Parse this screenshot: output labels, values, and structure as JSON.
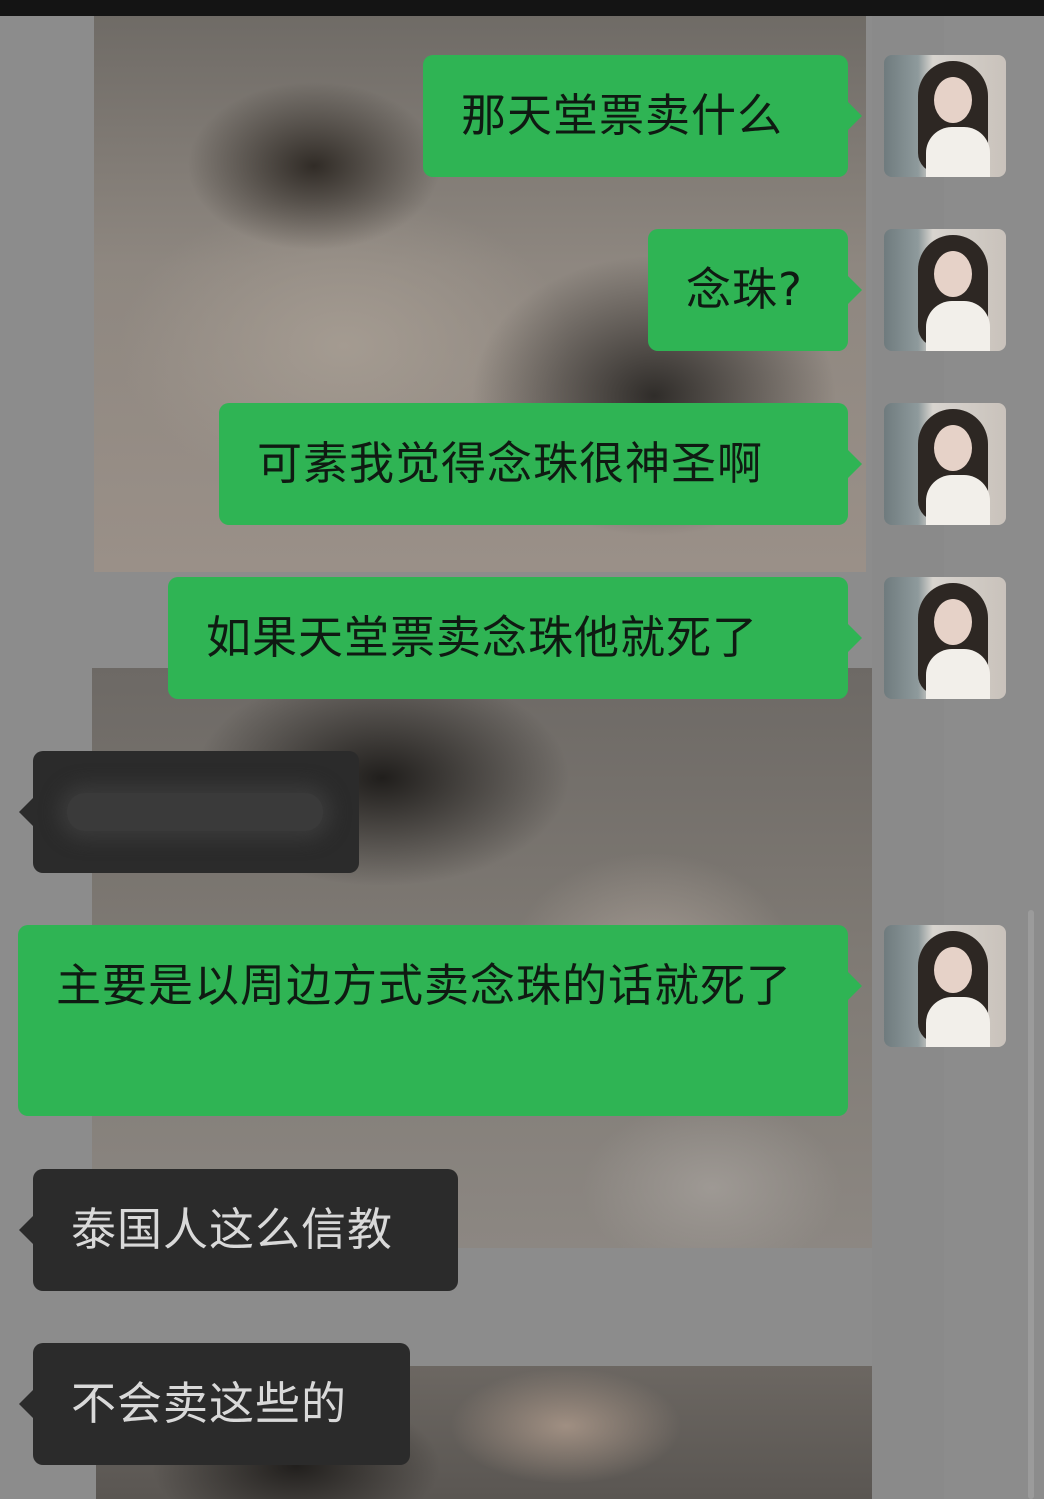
{
  "chat": {
    "messages": [
      {
        "id": "m1",
        "direction": "sent",
        "text": "那天堂票卖什么"
      },
      {
        "id": "m2",
        "direction": "sent",
        "text": "念珠?"
      },
      {
        "id": "m3",
        "direction": "sent",
        "text": "可素我觉得念珠很神圣啊"
      },
      {
        "id": "m4",
        "direction": "sent",
        "text": "如果天堂票卖念珠他就死了"
      },
      {
        "id": "m5",
        "direction": "received",
        "text": "",
        "redacted": true
      },
      {
        "id": "m6",
        "direction": "sent",
        "text": "主要是以周边方式卖念珠的话就死了"
      },
      {
        "id": "m7",
        "direction": "received",
        "text": "泰国人这么信教"
      },
      {
        "id": "m8",
        "direction": "received",
        "text": "不会卖这些的"
      }
    ]
  },
  "colors": {
    "sent_bubble": "#2fb454",
    "received_bubble": "#2b2b2b",
    "background": "#8c8c8c"
  },
  "icons": {
    "avatar": "user-avatar-photo"
  }
}
